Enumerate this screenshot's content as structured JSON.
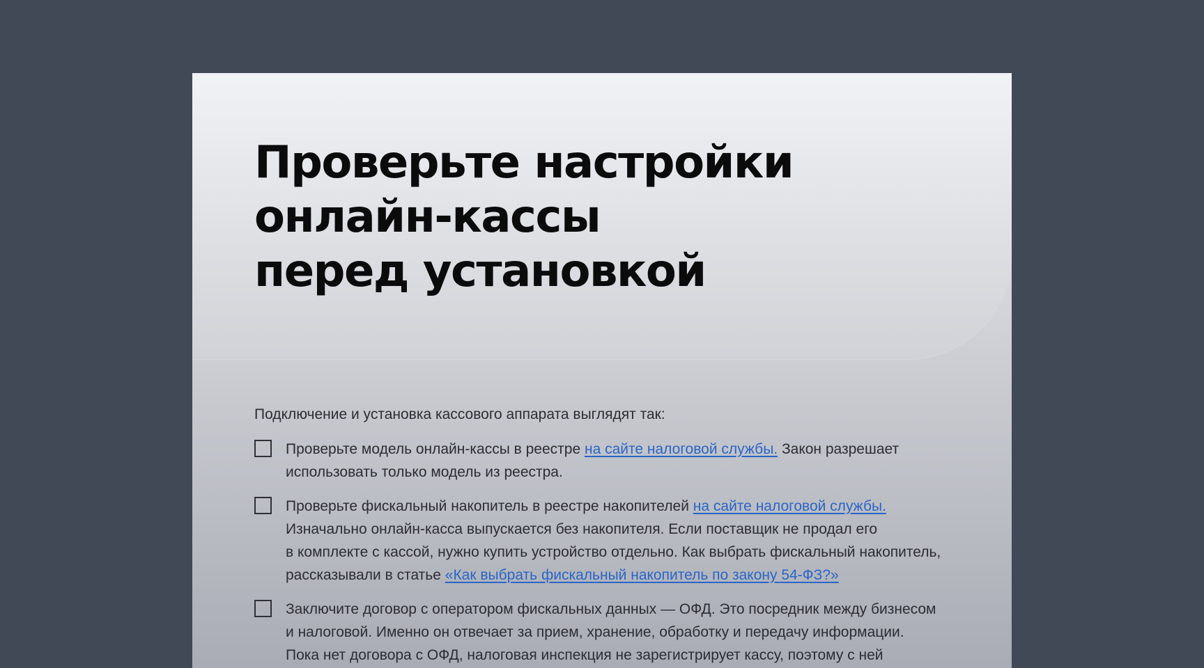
{
  "title": {
    "line1": "Проверьте настройки",
    "line2": "онлайн-кассы",
    "line3": "перед установкой"
  },
  "intro": "Подключение и установка кассового аппарата выглядят так:",
  "items": [
    {
      "l1_a": "Проверьте модель онлайн-кассы в реестре ",
      "l1_link": "на сайте налоговой службы.",
      "l1_b": " Закон разрешает",
      "l2": "использовать только модель из реестра."
    },
    {
      "l1_a": "Проверьте фискальный накопитель в реестре накопителей ",
      "l1_link": "на сайте налоговой службы.",
      "l2": "Изначально онлайн-касса выпускается без накопителя. Если поставщик не продал его",
      "l3": "в комплекте с кассой, нужно купить устройство отдельно. Как выбрать фискальный накопитель,",
      "l4_a": "рассказывали в статье ",
      "l4_link": "«Как выбрать фискальный накопитель по закону 54-ФЗ?»"
    },
    {
      "l1": "Заключите договор с оператором фискальных данных — ОФД. Это посредник между бизнесом",
      "l2": "и налоговой. Именно он отвечает за прием, хранение, обработку и передачу информации.",
      "l3": "Пока нет договора с ОФД, налоговая инспекция не зарегистрирует кассу, поэтому с ней"
    }
  ],
  "colors": {
    "page_background": "#414856",
    "card_top": "#f0f1f4",
    "card_bottom": "#a9acb4",
    "text": "#2b2d33",
    "heading": "#0b0b0c",
    "link": "#2a65c6"
  }
}
